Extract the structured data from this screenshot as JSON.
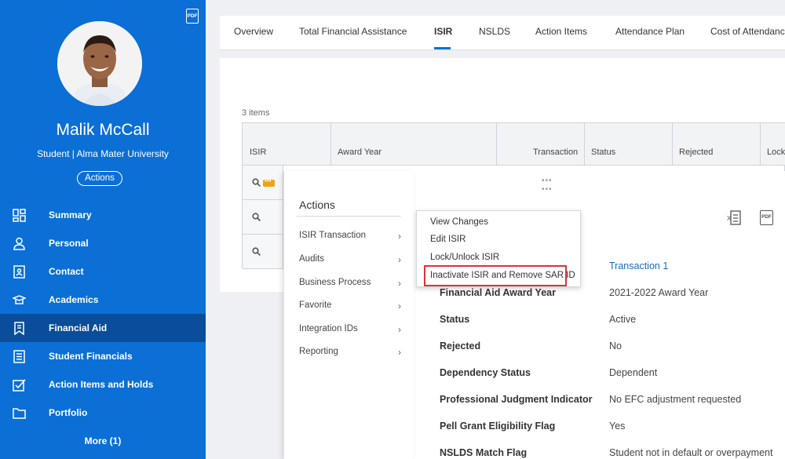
{
  "sidebar": {
    "pdf_label": "PDF",
    "user_name": "Malik McCall",
    "user_sub": "Student | Alma Mater University",
    "actions_label": "Actions",
    "items": [
      {
        "label": "Summary",
        "icon": "grid-icon"
      },
      {
        "label": "Personal",
        "icon": "person-icon"
      },
      {
        "label": "Contact",
        "icon": "contact-card-icon"
      },
      {
        "label": "Academics",
        "icon": "graduation-cap-icon"
      },
      {
        "label": "Financial Aid",
        "icon": "bookmark-icon",
        "active": true
      },
      {
        "label": "Student Financials",
        "icon": "list-icon"
      },
      {
        "label": "Action Items and Holds",
        "icon": "checkbox-icon"
      },
      {
        "label": "Portfolio",
        "icon": "folder-icon"
      }
    ],
    "more_label": "More (1)"
  },
  "tabs": [
    {
      "label": "Overview"
    },
    {
      "label": "Total Financial Assistance"
    },
    {
      "label": "ISIR",
      "active": true
    },
    {
      "label": "NSLDS"
    },
    {
      "label": "Action Items"
    },
    {
      "label": "Attendance Plan"
    },
    {
      "label": "Cost of Attendance"
    }
  ],
  "grid": {
    "items_count": "3 items",
    "headers": [
      "ISIR",
      "Award Year",
      "Transaction",
      "Status",
      "Rejected",
      "Lock"
    ]
  },
  "actions_menu": {
    "title": "Actions",
    "items": [
      {
        "label": "ISIR Transaction"
      },
      {
        "label": "Audits"
      },
      {
        "label": "Business Process"
      },
      {
        "label": "Favorite"
      },
      {
        "label": "Integration IDs"
      },
      {
        "label": "Reporting"
      }
    ]
  },
  "submenu": {
    "items": [
      {
        "label": "View Changes"
      },
      {
        "label": "Edit ISIR"
      },
      {
        "label": "Lock/Unlock ISIR"
      },
      {
        "label": "Inactivate ISIR and Remove SAR ID",
        "highlighted": true
      }
    ]
  },
  "detail": {
    "pdf_label": "PDF",
    "transaction_link": "Transaction 1",
    "fields": [
      {
        "label": "Financial Aid Award Year",
        "value": "2021-2022 Award Year"
      },
      {
        "label": "Status",
        "value": "Active"
      },
      {
        "label": "Rejected",
        "value": "No"
      },
      {
        "label": "Dependency Status",
        "value": "Dependent"
      },
      {
        "label": "Professional Judgment Indicator",
        "value": "No EFC adjustment requested"
      },
      {
        "label": "Pell Grant Eligibility Flag",
        "value": "Yes"
      },
      {
        "label": "NSLDS Match Flag",
        "value": "Student not in default or overpayment"
      }
    ]
  },
  "colors": {
    "sidebar": "#0b6fd6",
    "sidebar_active": "#0a4d9a",
    "highlight_border": "#d83535",
    "link": "#1b6ac9"
  }
}
